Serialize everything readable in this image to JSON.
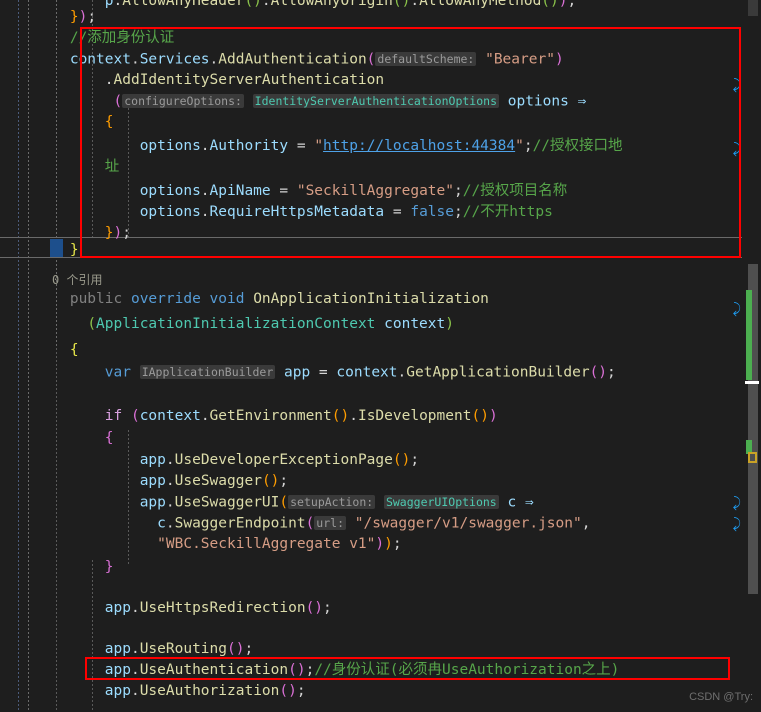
{
  "app": {
    "name": "code-editor",
    "theme": "dark-plus",
    "colors": {
      "background": "#1e1e1e",
      "foreground": "#d4d4d4",
      "comment": "#57a64a",
      "keyword": "#569cd6",
      "control_keyword": "#d8a0df",
      "type": "#4ec9b0",
      "method": "#dcdcaa",
      "variable": "#9cdcfe",
      "string": "#d69d85",
      "annotation_box": "#ff0000",
      "change_bar": "#4caf50",
      "bookmark": "#c9a226",
      "wrap_indicator": "#1f9cf0"
    }
  },
  "watermark": {
    "text": "CSDN @Try:"
  },
  "codelens": {
    "references_label": "0 个引用"
  },
  "annotations": [
    {
      "name": "authentication-block-highlight",
      "note": "red rectangle around AddAuthentication block"
    },
    {
      "name": "use-authentication-line-highlight",
      "note": "red rectangle around app.UseAuthentication() line"
    }
  ],
  "code": {
    "lines": [
      {
        "id": "l01",
        "text": "            p.AllowAnyHeader().AllowAnyOrigin().AllowAnyMethod());"
      },
      {
        "id": "l02",
        "text": "        });"
      },
      {
        "id": "l03",
        "text": "        //添加身份认证"
      },
      {
        "id": "l04",
        "text": "        context.Services.AddAuthentication(defaultScheme: \"Bearer\")"
      },
      {
        "id": "l05",
        "text": "            .AddIdentityServerAuthentication"
      },
      {
        "id": "l06",
        "text": "            (configureOptions: IdentityServerAuthenticationOptions options =>"
      },
      {
        "id": "l07",
        "text": "            {"
      },
      {
        "id": "l08",
        "text": "                options.Authority = \"http://localhost:44384\";//授权接口地"
      },
      {
        "id": "l09",
        "text": "            址"
      },
      {
        "id": "l10",
        "text": "                options.ApiName = \"SeckillAggregate\";//授权项目名称"
      },
      {
        "id": "l11",
        "text": "                options.RequireHttpsMetadata = false;//不开https"
      },
      {
        "id": "l12",
        "text": "            });"
      },
      {
        "id": "l13",
        "text": "        }"
      },
      {
        "id": "l14",
        "text": "        public override void OnApplicationInitialization"
      },
      {
        "id": "l15",
        "text": "          (ApplicationInitializationContext context)"
      },
      {
        "id": "l16",
        "text": "        {"
      },
      {
        "id": "l17",
        "text": "            var IApplicationBuilder app = context.GetApplicationBuilder();"
      },
      {
        "id": "l18",
        "text": ""
      },
      {
        "id": "l19",
        "text": "            if (context.GetEnvironment().IsDevelopment())"
      },
      {
        "id": "l20",
        "text": "            {"
      },
      {
        "id": "l21",
        "text": "                app.UseDeveloperExceptionPage();"
      },
      {
        "id": "l22",
        "text": "                app.UseSwagger();"
      },
      {
        "id": "l23",
        "text": "                app.UseSwaggerUI(setupAction: SwaggerUIOptions c =>"
      },
      {
        "id": "l24",
        "text": "                  c.SwaggerEndpoint(url: \"/swagger/v1/swagger.json\","
      },
      {
        "id": "l25",
        "text": "                  \"WBC.SeckillAggregate v1\"));"
      },
      {
        "id": "l26",
        "text": "            }"
      },
      {
        "id": "l27",
        "text": ""
      },
      {
        "id": "l28",
        "text": "            app.UseHttpsRedirection();"
      },
      {
        "id": "l29",
        "text": ""
      },
      {
        "id": "l30",
        "text": "            app.UseRouting();"
      },
      {
        "id": "l31",
        "text": "            app.UseAuthentication();//身份认证(必须冉UseAuthorization之上)"
      },
      {
        "id": "l32",
        "text": "            app.UseAuthorization();"
      }
    ],
    "identifiers": {
      "comment_add_auth": "//添加身份认证",
      "comment_authority": "//授权接口地址",
      "comment_apiname": "//授权项目名称",
      "comment_https": "//不开https",
      "comment_use_auth": "//身份认证(必须冉UseAuthorization之上)",
      "url_authority": "http://localhost:44384",
      "api_name": "SeckillAggregate",
      "swagger_endpoint_url": "/swagger/v1/swagger.json",
      "swagger_title": "WBC.SeckillAggregate v1",
      "default_scheme": "Bearer",
      "hint_default_scheme": "defaultScheme:",
      "hint_configure_options": "configureOptions:",
      "hint_setup_action": "setupAction:",
      "hint_url": "url:",
      "type_ids_options": "IdentityServerAuthenticationOptions",
      "type_app_builder": "IApplicationBuilder",
      "type_swagger_ui_options": "SwaggerUIOptions"
    }
  }
}
